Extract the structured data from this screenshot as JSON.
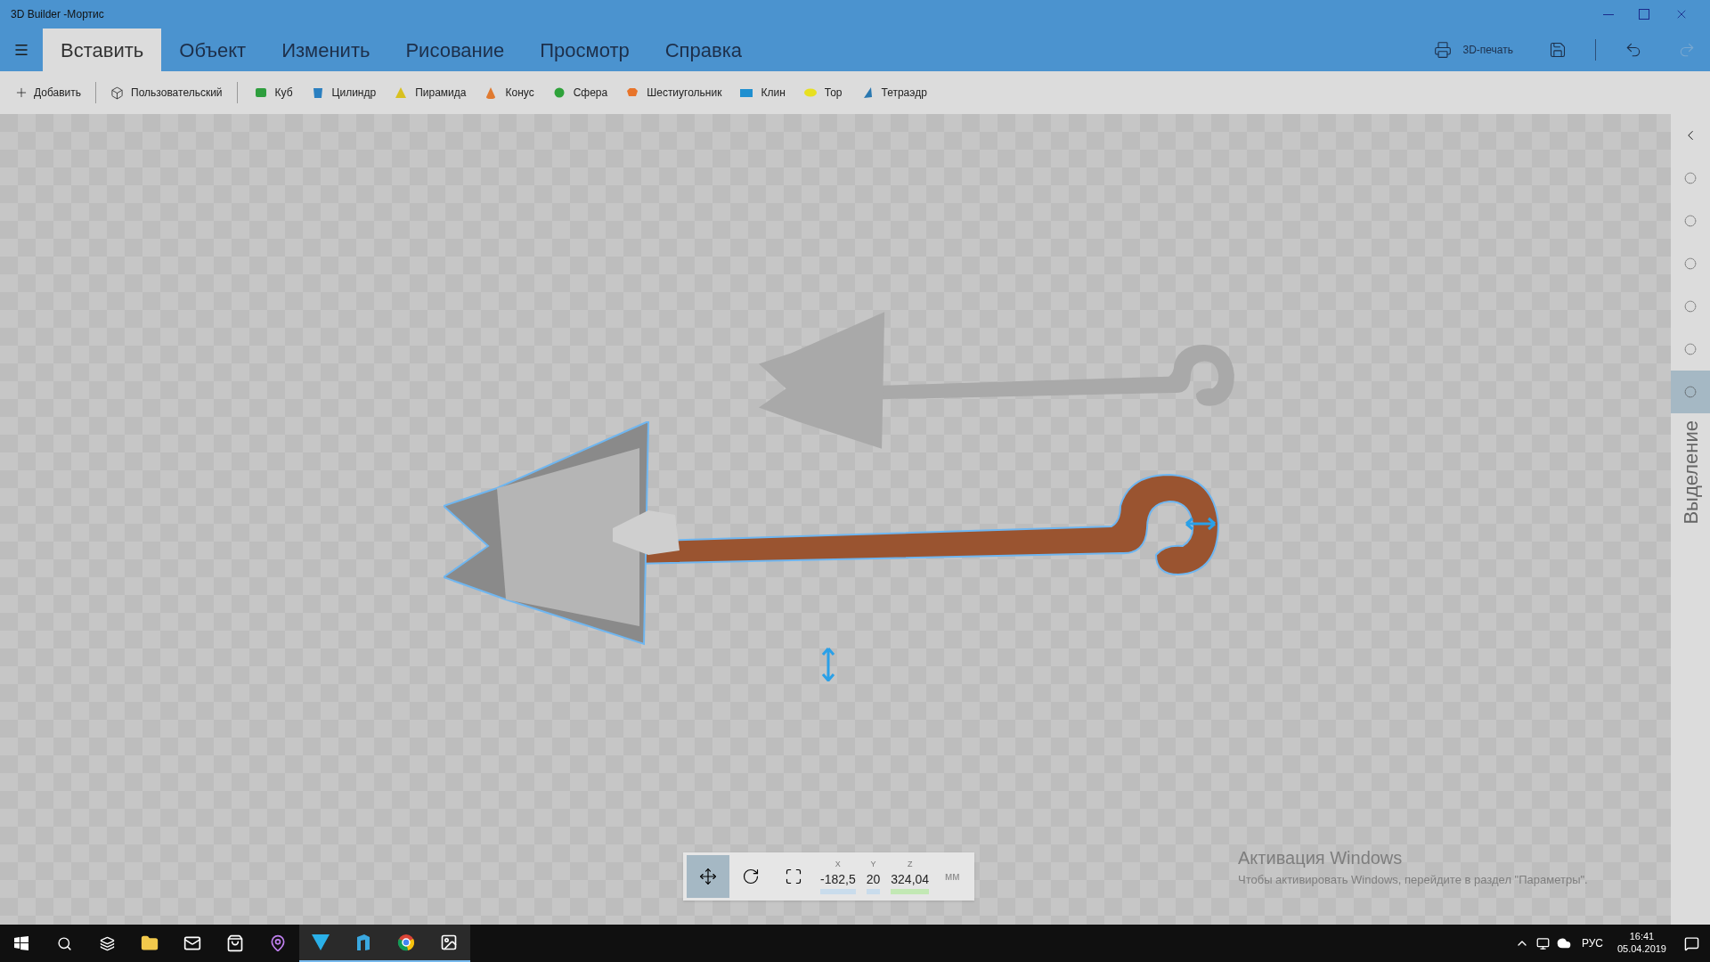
{
  "window": {
    "title": "3D Builder -Мортис"
  },
  "tabs": [
    {
      "label": "Вставить",
      "selected": true
    },
    {
      "label": "Объект",
      "selected": false
    },
    {
      "label": "Изменить",
      "selected": false
    },
    {
      "label": "Рисование",
      "selected": false
    },
    {
      "label": "Просмотр",
      "selected": false
    },
    {
      "label": "Справка",
      "selected": false
    }
  ],
  "header_actions": {
    "print_label": "3D-печать"
  },
  "toolbar": [
    {
      "kind": "add",
      "label": "Добавить"
    },
    {
      "kind": "custom",
      "label": "Пользовательский"
    },
    {
      "kind": "shape",
      "label": "Куб",
      "color": "#2e9e3e"
    },
    {
      "kind": "shape",
      "label": "Цилиндр",
      "color": "#2a7fc0"
    },
    {
      "kind": "shape",
      "label": "Пирамида",
      "color": "#d8c020"
    },
    {
      "kind": "shape",
      "label": "Конус",
      "color": "#e07a30"
    },
    {
      "kind": "shape",
      "label": "Сфера",
      "color": "#2ea23a"
    },
    {
      "kind": "shape",
      "label": "Шестиугольник",
      "color": "#e8742a"
    },
    {
      "kind": "shape",
      "label": "Клин",
      "color": "#1f8fd0"
    },
    {
      "kind": "shape",
      "label": "Тор",
      "color": "#e8e020"
    },
    {
      "kind": "shape",
      "label": "Тетраэдр",
      "color": "#2a78b0"
    }
  ],
  "side_panel": {
    "label": "Выделение",
    "tools": [
      {
        "selected": false
      },
      {
        "selected": false
      },
      {
        "selected": false
      },
      {
        "selected": false
      },
      {
        "selected": false
      },
      {
        "selected": true
      }
    ]
  },
  "transform_bar": {
    "modes": [
      {
        "kind": "move",
        "selected": true
      },
      {
        "kind": "rotate",
        "selected": false
      },
      {
        "kind": "scale",
        "selected": false
      }
    ],
    "fields": [
      {
        "axis": "X",
        "value": "-182,5"
      },
      {
        "axis": "Y",
        "value": "20"
      },
      {
        "axis": "Z",
        "value": "324,04"
      }
    ],
    "unit": "мм"
  },
  "activation_notice": {
    "title": "Активация Windows",
    "text": "Чтобы активировать Windows, перейдите в раздел \"Параметры\"."
  },
  "taskbar": {
    "language": "РУС",
    "time": "16:41",
    "date": "05.04.2019"
  }
}
